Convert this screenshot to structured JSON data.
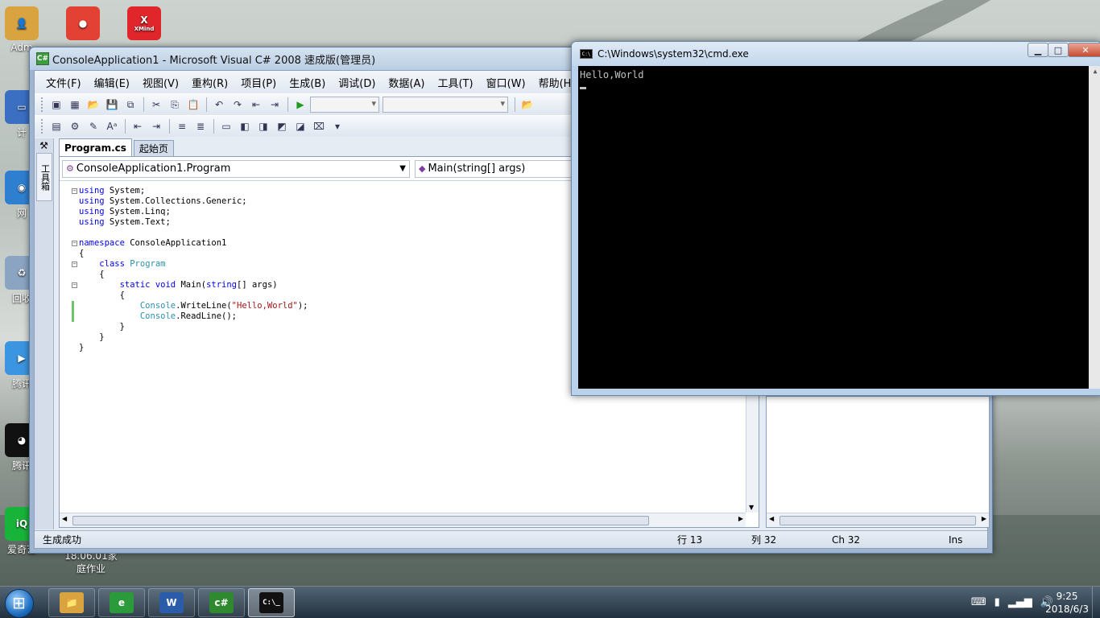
{
  "desktop": {
    "icons": [
      {
        "label": "Adm",
        "glyph": "👤",
        "color": "#d9a440"
      },
      {
        "label": "",
        "glyph": "●",
        "color": "#e34133"
      },
      {
        "label": "",
        "glyph": "X",
        "color": "#e0262b"
      },
      {
        "label": "计",
        "glyph": "▭",
        "color": "#3a6fc2"
      },
      {
        "label": "网",
        "glyph": "◉",
        "color": "#2f7fd0"
      },
      {
        "label": "回收",
        "glyph": "♻",
        "color": "#8aa4c2"
      },
      {
        "label": "腾讯",
        "glyph": "▶",
        "color": "#3b95e0"
      },
      {
        "label": "腾讯",
        "glyph": "◕",
        "color": "#111"
      },
      {
        "label": "爱奇艺",
        "glyph": "iQ",
        "color": "#18b43a"
      }
    ],
    "xmind_label": "XMind",
    "folder_text": "18.06.01家庭作业"
  },
  "vs": {
    "title": "ConsoleApplication1 - Microsoft Visual C# 2008 速成版(管理员)",
    "menu": [
      "文件(F)",
      "编辑(E)",
      "视图(V)",
      "重构(R)",
      "项目(P)",
      "生成(B)",
      "调试(D)",
      "数据(A)",
      "工具(T)",
      "窗口(W)",
      "帮助(H)"
    ],
    "toolbox_label": "工具箱",
    "tabs": [
      "Program.cs",
      "起始页"
    ],
    "nav_class": "ConsoleApplication1.Program",
    "nav_member": "Main(string[] args)",
    "code": [
      [
        {
          "t": "using",
          "c": "kw"
        },
        {
          "t": " System;"
        }
      ],
      [
        {
          "t": "using",
          "c": "kw"
        },
        {
          "t": " System.Collections.Generic;"
        }
      ],
      [
        {
          "t": "using",
          "c": "kw"
        },
        {
          "t": " System.Linq;"
        }
      ],
      [
        {
          "t": "using",
          "c": "kw"
        },
        {
          "t": " System.Text;"
        }
      ],
      [],
      [
        {
          "t": "namespace",
          "c": "kw"
        },
        {
          "t": " ConsoleApplication1"
        }
      ],
      [
        {
          "t": "{"
        }
      ],
      [
        {
          "t": "    "
        },
        {
          "t": "class",
          "c": "kw"
        },
        {
          "t": " "
        },
        {
          "t": "Program",
          "c": "ty"
        }
      ],
      [
        {
          "t": "    {"
        }
      ],
      [
        {
          "t": "        "
        },
        {
          "t": "static",
          "c": "kw"
        },
        {
          "t": " "
        },
        {
          "t": "void",
          "c": "kw"
        },
        {
          "t": " Main("
        },
        {
          "t": "string",
          "c": "kw"
        },
        {
          "t": "[] args)"
        }
      ],
      [
        {
          "t": "        {"
        }
      ],
      [
        {
          "t": "            "
        },
        {
          "t": "Console",
          "c": "ty"
        },
        {
          "t": ".WriteLine("
        },
        {
          "t": "\"Hello,World\"",
          "c": "st"
        },
        {
          "t": ");"
        }
      ],
      [
        {
          "t": "            "
        },
        {
          "t": "Console",
          "c": "ty"
        },
        {
          "t": ".ReadLine();"
        }
      ],
      [
        {
          "t": "        }"
        }
      ],
      [
        {
          "t": "    }"
        }
      ],
      [
        {
          "t": "}"
        }
      ]
    ],
    "status": {
      "message": "生成成功",
      "line": "行 13",
      "col": "列 32",
      "ch": "Ch 32",
      "mode": "Ins"
    }
  },
  "cmd": {
    "title": "C:\\Windows\\system32\\cmd.exe",
    "output": "Hello,World",
    "icon_text": "C:\\"
  },
  "taskbar": {
    "apps": [
      {
        "name": "explorer",
        "glyph": "📁",
        "color": "#d9a440"
      },
      {
        "name": "ie",
        "glyph": "e",
        "color": "#2a9a3a"
      },
      {
        "name": "word",
        "glyph": "W",
        "color": "#2a5caa"
      },
      {
        "name": "csharp",
        "glyph": "c#",
        "color": "#2f8a2f"
      },
      {
        "name": "cmd",
        "glyph": "C:\\_",
        "color": "#111"
      }
    ],
    "time": "9:25",
    "date": "2018/6/3"
  }
}
